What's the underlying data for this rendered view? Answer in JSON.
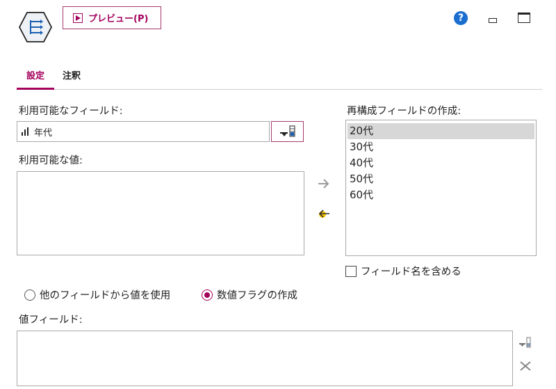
{
  "header": {
    "preview_label": "プレビュー(P)",
    "help_glyph": "?"
  },
  "tabs": [
    {
      "label": "設定",
      "active": true
    },
    {
      "label": "注釈",
      "active": false
    }
  ],
  "available_fields": {
    "label": "利用可能なフィールド:",
    "selected_value": "年代"
  },
  "available_values": {
    "label": "利用可能な値:",
    "items": []
  },
  "reconstructed_fields": {
    "label": "再構成フィールドの作成:",
    "items": [
      "20代",
      "30代",
      "40代",
      "50代",
      "60代"
    ],
    "selected_index": 0
  },
  "include_field_name": {
    "label": "フィールド名を含める",
    "checked": false
  },
  "mode": {
    "options": [
      {
        "label": "他のフィールドから値を使用",
        "checked": false
      },
      {
        "label": "数値フラグの作成",
        "checked": true
      }
    ]
  },
  "value_field": {
    "label": "値フィールド:",
    "items": []
  },
  "colors": {
    "accent": "#a3005c",
    "help_blue": "#1a6fd0",
    "selection": "#d7d7d7",
    "arrow_yellow": "#f5c400"
  }
}
